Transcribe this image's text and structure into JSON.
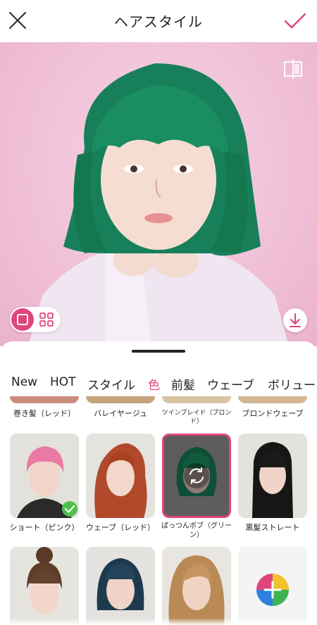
{
  "header": {
    "title": "ヘアスタイル"
  },
  "colors": {
    "accent": "#e0457b",
    "check_green": "#4cc04a",
    "hair_green": "#1e8a5e",
    "preview_bg": "#f0c0d6"
  },
  "tabs": [
    {
      "label": "New"
    },
    {
      "label": "HOT"
    },
    {
      "label": "スタイル"
    },
    {
      "label": "色"
    },
    {
      "label": "前髪"
    },
    {
      "label": "ウェーブ"
    },
    {
      "label": "ボリュー"
    }
  ],
  "active_tab": "色",
  "top_partial_items": [
    {
      "label": "巻き髪（レッド）"
    },
    {
      "label": "バレイヤージュ"
    },
    {
      "label": "ツインブレイド（ブロンド）"
    },
    {
      "label": "ブロンドウェーブ"
    }
  ],
  "styles": [
    {
      "label": "ショート（ピンク）",
      "selected": false,
      "applied": true
    },
    {
      "label": "ウェーブ（レッド）",
      "selected": false,
      "applied": false
    },
    {
      "label": "ぱっつんボブ（グリーン）",
      "selected": true,
      "applied": false
    },
    {
      "label": "黒髪ストレート",
      "selected": false,
      "applied": false
    }
  ],
  "icons": [
    "close-icon",
    "check-icon",
    "compare-icon",
    "single-view-icon",
    "grid-view-icon",
    "download-icon",
    "refresh-icon",
    "color-wheel-add-icon"
  ]
}
